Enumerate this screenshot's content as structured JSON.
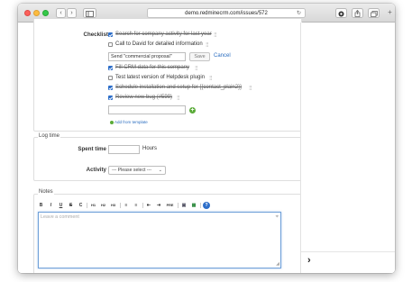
{
  "browser": {
    "url": "demo.redminecrm.com/issues/572",
    "back_glyph": "‹",
    "forward_glyph": "›",
    "reload_glyph": "↻",
    "new_tab_glyph": "+"
  },
  "checklist": {
    "label": "Checklist",
    "items": [
      {
        "text": "Search for company activity for last year",
        "done": true
      },
      {
        "text": "Call to David for detailed information",
        "done": false
      },
      {
        "text": "Fill CRM data for this company",
        "done": true
      },
      {
        "text": "Test latest version of Helpdesk plugin",
        "done": false
      },
      {
        "text": "Schedule installation and setup for {{contact_plain2}}",
        "done": true
      },
      {
        "text": "Review new bug (#599)",
        "done": true
      }
    ],
    "edit_value": "Send \"commercial proposal\"",
    "save_label": "Save",
    "cancel_label": "Cancel",
    "add_template_label": "Add from template",
    "handle_glyph": "⣿"
  },
  "log_time": {
    "legend": "Log time",
    "spent_label": "Spent time",
    "spent_value": "",
    "unit": "Hours",
    "activity_label": "Activity",
    "activity_selected": "--- Please select ---"
  },
  "notes": {
    "legend": "Notes",
    "toolbar": [
      "B",
      "I",
      "U",
      "S",
      "C",
      "H1",
      "H2",
      "H3",
      "≡",
      "≡",
      "⇤",
      "⇥",
      "PRE",
      "▣",
      "▦",
      "?"
    ],
    "placeholder": "Leave a comment"
  },
  "right_pane": {
    "arrow": "›"
  },
  "colors": {
    "link": "#2a6dc0",
    "checkbox": "#2d6ec9",
    "add_icon": "#5aab38",
    "focus_border": "#6fa0d8"
  }
}
